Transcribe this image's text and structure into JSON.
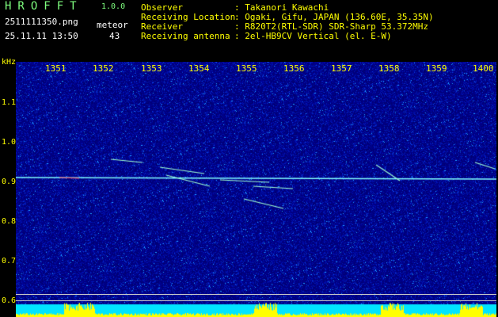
{
  "app": {
    "logo": "HROFFT",
    "version": "1.0.0"
  },
  "file": {
    "name": "2511111350.png",
    "datetime": "25.11.11 13:50",
    "meteor_label": "meteor",
    "meteor_count": "43"
  },
  "info": {
    "labels": [
      "Observer",
      "Receiving Location",
      "Receiver",
      "Receiving antenna"
    ],
    "values": [
      ": Takanori Kawachi",
      ": Ogaki, Gifu, JAPAN (136.60E, 35.35N)",
      ": R820T2(RTL-SDR) SDR-Sharp 53.372MHz",
      ": 2el-HB9CV Vertical (el. E-W)"
    ]
  },
  "axis": {
    "unit": "kHz",
    "time_ticks": [
      "1351",
      "1352",
      "1353",
      "1354",
      "1355",
      "1356",
      "1357",
      "1358",
      "1359",
      "1400"
    ],
    "freq_ticks": [
      "1.1",
      "1.0",
      "0.9",
      "0.8",
      "0.7",
      "0.6"
    ]
  },
  "colors": {
    "header_text": "#ffff00",
    "logo": "#7fff7f",
    "background": "#00008b",
    "carrier": "#80ffff",
    "bottom_bar": "#00e5ff",
    "bottom_peaks": "#ffff00"
  }
}
